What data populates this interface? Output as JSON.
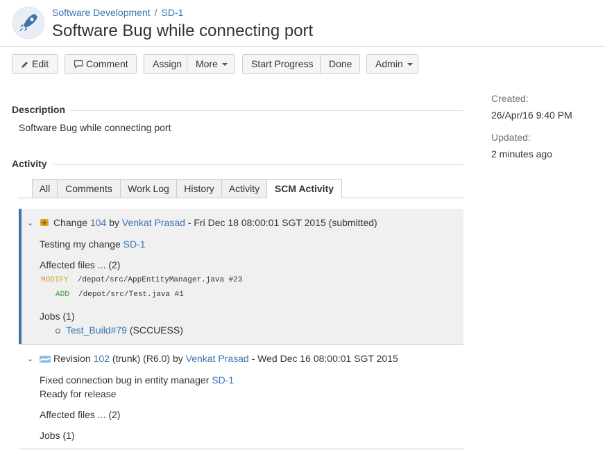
{
  "breadcrumb": {
    "project": "Software Development",
    "separator": "/",
    "issue_key": "SD-1"
  },
  "title": "Software Bug while connecting port",
  "toolbar": {
    "edit": "Edit",
    "comment": "Comment",
    "assign": "Assign",
    "more": "More",
    "start_progress": "Start Progress",
    "done": "Done",
    "admin": "Admin"
  },
  "description": {
    "heading": "Description",
    "text": "Software Bug while connecting port"
  },
  "dates": {
    "created_label": "Created:",
    "created_value": "26/Apr/16 9:40 PM",
    "updated_label": "Updated:",
    "updated_value": "2 minutes ago"
  },
  "activity": {
    "heading": "Activity",
    "tabs": [
      "All",
      "Comments",
      "Work Log",
      "History",
      "Activity",
      "SCM Activity"
    ],
    "active_tab": "SCM Activity",
    "entries": [
      {
        "type_label": "Change",
        "number": "104",
        "by": "by",
        "author": "Venkat Prasad",
        "suffix": "- Fri Dec 18 08:00:01 SGT 2015 (submitted)",
        "message": "Testing my change",
        "issue_link": "SD-1",
        "affected_files": "Affected files ... (2)",
        "files": [
          {
            "action": "MODIFY",
            "path": "/depot/src/AppEntityManager.java #23"
          },
          {
            "action": "ADD",
            "path": "/depot/src/Test.java #1"
          }
        ],
        "jobs": "Jobs (1)",
        "job_name": "Test_Build#79",
        "job_status": "(SCCUESS)"
      },
      {
        "type_label": "Revision",
        "number": "102",
        "middle": "(trunk) (R6.0) by",
        "author": "Venkat Prasad",
        "suffix": "- Wed Dec 16 08:00:01 SGT 2015",
        "message_line1": "Fixed connection bug in entity manager",
        "issue_link": "SD-1",
        "message_line2": "Ready for release",
        "affected_files": "Affected files ... (2)",
        "jobs": "Jobs (1)"
      }
    ]
  },
  "colors": {
    "link": "#3b73af",
    "accent_bar": "#3b73af",
    "modify": "#d29b2a",
    "add": "#3a9a3a"
  }
}
